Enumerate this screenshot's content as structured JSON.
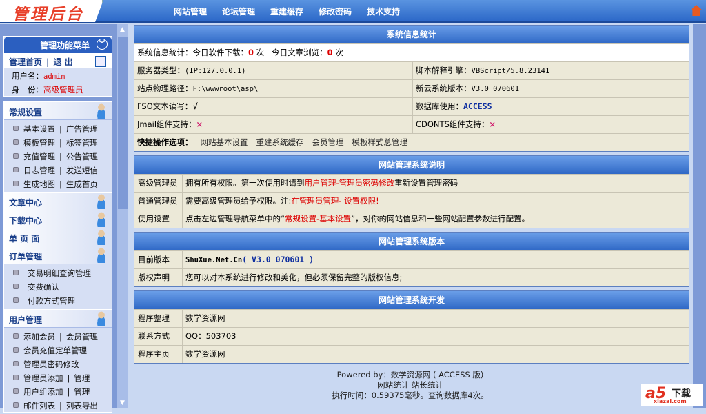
{
  "header": {
    "logo": "管理后台",
    "nav": [
      "网站管理",
      "论坛管理",
      "重建缓存",
      "修改密码",
      "技术支持"
    ]
  },
  "sidebar": {
    "title": "管理功能菜单",
    "home": "管理首页",
    "logout": "退 出",
    "user_label": "用户名：",
    "user": "admin",
    "role_label": "身　份：",
    "role": "高级管理员",
    "sections": [
      {
        "title": "常规设置",
        "items": [
          [
            "基本设置",
            "广告管理"
          ],
          [
            "模板管理",
            "标签管理"
          ],
          [
            "充值管理",
            "公告管理"
          ],
          [
            "日志管理",
            "发送短信"
          ],
          [
            "生成地图",
            "生成首页"
          ]
        ]
      },
      {
        "title": "文章中心"
      },
      {
        "title": "下载中心"
      },
      {
        "title": "单 页 面"
      },
      {
        "title": "订单管理",
        "items": [
          [
            "交易明细查询管理"
          ],
          [
            "交费确认"
          ],
          [
            "付款方式管理"
          ]
        ]
      },
      {
        "title": "用户管理",
        "items": [
          [
            "添加会员",
            "会员管理"
          ],
          [
            "会员充值定单管理"
          ],
          [
            "管理员密码修改"
          ],
          [
            "管理员添加",
            "管理"
          ],
          [
            "用户组添加",
            "管理"
          ],
          [
            "邮件列表",
            "列表导出"
          ]
        ]
      }
    ]
  },
  "sysinfo": {
    "title": "系统信息统计",
    "stats_label": "系统信息统计：今日软件下载：",
    "downloads": "0",
    "unit": "次",
    "views_label": "今日文章浏览：",
    "views": "0",
    "rows": [
      [
        "服务器类型：",
        "(IP:127.0.0.1)",
        "脚本解释引擎：",
        "VBScript/5.8.23141"
      ],
      [
        "站点物理路径：",
        "F:\\wwwroot\\asp\\",
        "新云系统版本：",
        "V3.0 070601"
      ],
      [
        "FSO文本读写：",
        "√",
        "数据库使用：",
        "ACCESS"
      ],
      [
        "Jmail组件支持：",
        "×",
        "CDONTS组件支持：",
        "×"
      ]
    ],
    "quick_label": "快捷操作选项：",
    "quick": [
      "网站基本设置",
      "重建系统缓存",
      "会员管理",
      "模板样式总管理"
    ]
  },
  "desc": {
    "title": "网站管理系统说明",
    "r1": {
      "label": "高级管理员",
      "pre": "拥有所有权限。第一次使用时请到",
      "link": "用户管理-管理员密码修改",
      "post": "重新设置管理密码"
    },
    "r2": {
      "label": "普通管理员",
      "pre": "需要高级管理员给予权限。注:",
      "red": "在管理员管理- 设置权限!"
    },
    "r3": {
      "label": "使用设置",
      "text": "点击左边管理导航菜单中的“",
      "red": "常规设置-基本设置",
      "post": "”，对你的网站信息和一些网站配置参数进行配置。"
    }
  },
  "version": {
    "title": "网站管理系统版本",
    "r1": {
      "label": "目前版本",
      "name": "ShuXue.Net.Cn",
      "ver": "( V3.0 070601 )"
    },
    "r2": {
      "label": "版权声明",
      "text": "您可以对本系统进行修改和美化，但必须保留完整的版权信息;"
    }
  },
  "dev": {
    "title": "网站管理系统开发",
    "rows": [
      [
        "程序整理",
        "数学资源网"
      ],
      [
        "联系方式",
        "QQ：503703"
      ],
      [
        "程序主页",
        "数学资源网"
      ]
    ]
  },
  "footer": {
    "powered": "Powered by：数学资源网 ( ACCESS 版)",
    "stats": "网站统计  站长统计",
    "exec": "执行时间：0.59375毫秒。查询数据库4次。"
  },
  "watermark": {
    "logo": "a5",
    "text": "下载",
    "url": "xiazai.com"
  }
}
